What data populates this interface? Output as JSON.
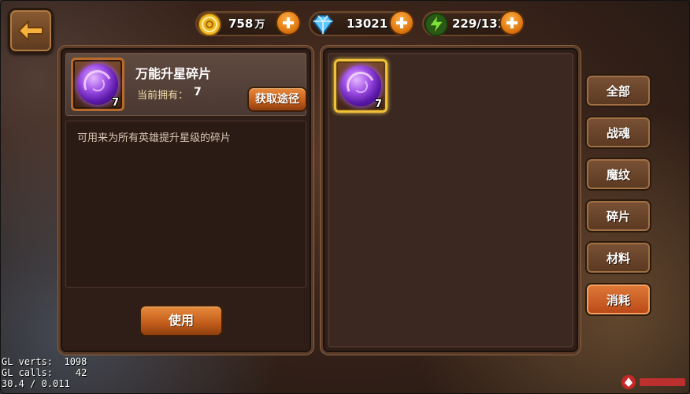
{
  "currencies": {
    "gold": {
      "value": "758",
      "unit": "万",
      "icon": "gold-coin-icon"
    },
    "diamond": {
      "value": "13021",
      "icon": "diamond-icon"
    },
    "stamina": {
      "value": "229/131",
      "icon": "lightning-icon"
    }
  },
  "detail": {
    "item_name": "万能升星碎片",
    "owned_label": "当前拥有：",
    "owned_value": "7",
    "quantity": "7",
    "obtain_button": "获取途径",
    "description": "可用来为所有英雄提升星级的碎片",
    "use_button": "使用"
  },
  "inventory": {
    "items": [
      {
        "icon": "purple-shard-orb-icon",
        "quantity": "7",
        "selected": true
      }
    ]
  },
  "tabs": [
    {
      "label": "全部",
      "active": false
    },
    {
      "label": "战魂",
      "active": false
    },
    {
      "label": "魔纹",
      "active": false
    },
    {
      "label": "碎片",
      "active": false
    },
    {
      "label": "材料",
      "active": false
    },
    {
      "label": "消耗",
      "active": true
    }
  ],
  "debug": {
    "line1": "GL verts:  1098",
    "line2": "GL calls:    42",
    "line3": "30.4 / 0.011"
  },
  "colors": {
    "accent": "#e07a38",
    "panel": "#2f1e17",
    "selected_border": "#f0c238"
  }
}
